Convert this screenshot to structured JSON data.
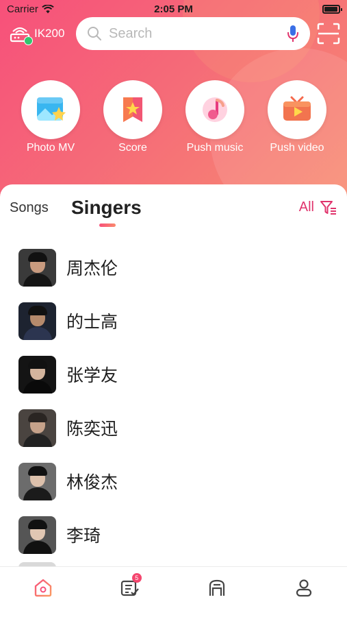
{
  "status_bar": {
    "carrier": "Carrier",
    "time": "2:05 PM"
  },
  "device": {
    "name": "IK200",
    "icon": "router-icon",
    "status_icon": "check-icon"
  },
  "search": {
    "placeholder": "Search",
    "icon": "search-icon",
    "voice_icon": "microphone-icon",
    "scan_icon": "scan-icon"
  },
  "shortcuts": [
    {
      "label": "Photo MV",
      "icon": "photo-mv-icon"
    },
    {
      "label": "Score",
      "icon": "score-icon"
    },
    {
      "label": "Push music",
      "icon": "push-music-icon"
    },
    {
      "label": "Push video",
      "icon": "push-video-icon"
    }
  ],
  "tabs": {
    "songs": "Songs",
    "singers": "Singers",
    "active": "Singers"
  },
  "filter": {
    "label": "All",
    "icon": "filter-icon"
  },
  "singers": [
    {
      "name": "周杰伦"
    },
    {
      "name": "的士高"
    },
    {
      "name": "张学友"
    },
    {
      "name": "陈奕迅"
    },
    {
      "name": "林俊杰"
    },
    {
      "name": "李琦"
    }
  ],
  "tabbar": {
    "items": [
      {
        "icon": "home-icon",
        "active": true
      },
      {
        "icon": "playlist-icon",
        "badge": "5"
      },
      {
        "icon": "device-icon"
      },
      {
        "icon": "profile-icon"
      }
    ]
  },
  "colors": {
    "accent": "#e0336c",
    "hero_start": "#f7507a",
    "hero_end": "#f88d72"
  }
}
